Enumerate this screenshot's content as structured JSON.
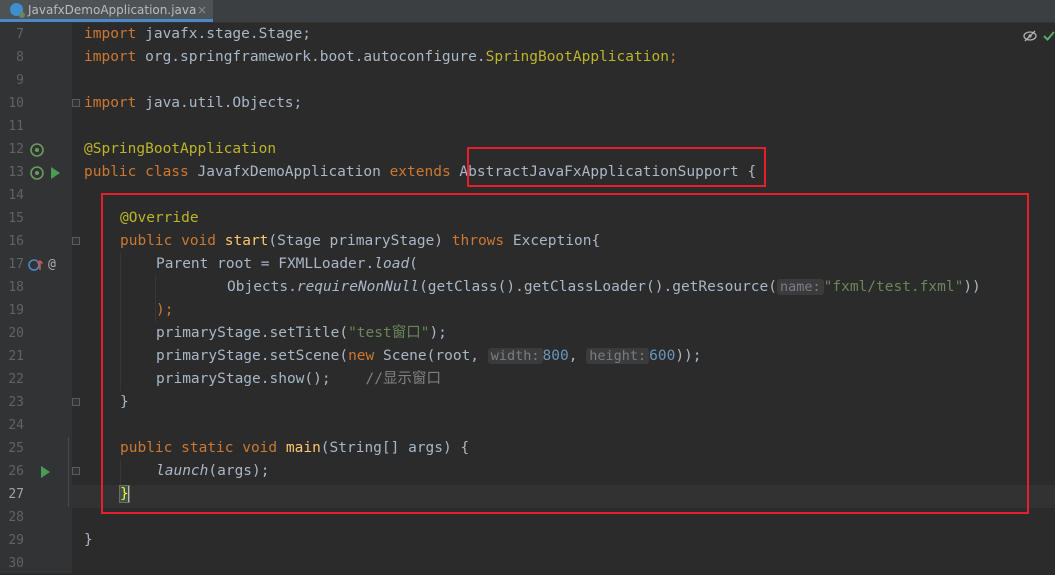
{
  "tab": {
    "file_name": "JavafxDemoApplication.java",
    "close_glyph": "×"
  },
  "gutter": {
    "line_numbers": [
      "7",
      "8",
      "9",
      "10",
      "11",
      "12",
      "13",
      "14",
      "15",
      "16",
      "17",
      "18",
      "19",
      "20",
      "21",
      "22",
      "23",
      "24",
      "25",
      "26",
      "27",
      "28",
      "29",
      "30"
    ],
    "current_line": "27",
    "icons": {
      "spring_bean": "spring-bean-icon",
      "run": "run-icon",
      "override": "override-icon",
      "annotation": "annotation-icon"
    }
  },
  "code": {
    "l7": [
      "import",
      " javafx.stage.Stage;"
    ],
    "l8": [
      "import",
      " org.springframework.boot.autoconfigure.",
      "SpringBootApplication",
      ";"
    ],
    "l10": [
      "import",
      " java.util.Objects;"
    ],
    "l12": [
      "@SpringBootApplication"
    ],
    "l13": [
      "public class",
      " JavafxDemoApplication ",
      "extends",
      " ",
      "AbstractJavaFxApplicationSupport",
      " {"
    ],
    "l15": [
      "@Override"
    ],
    "l16": [
      "public void",
      " ",
      "start",
      "(Stage primaryStage) ",
      "throws",
      " Exception{"
    ],
    "l17": [
      "Parent root = FXMLLoader.",
      "load",
      "("
    ],
    "l18": [
      "Objects.",
      "requireNonNull",
      "(getClass().getClassLoader().getResource(",
      "name:",
      "\"fxml/test.fxml\"",
      "))"
    ],
    "l19": [
      ");"
    ],
    "l20": [
      "primaryStage.setTitle(",
      "\"test窗口\"",
      ");"
    ],
    "l21": [
      "primaryStage.setScene(",
      "new",
      " Scene(root, ",
      "width:",
      "800",
      ", ",
      "height:",
      "600",
      "));"
    ],
    "l22": [
      "primaryStage.show();",
      "//显示窗口"
    ],
    "l23": [
      "}"
    ],
    "l25": [
      "public static void",
      " ",
      "main",
      "(String[] args) {"
    ],
    "l26": [
      "launch",
      "(args);"
    ],
    "l27": [
      "}"
    ],
    "l29": [
      "}"
    ]
  },
  "status": {
    "hide_icon": "eye-crossed-icon",
    "ok_icon": "check-icon"
  },
  "colors": {
    "background": "#2b2b2b",
    "keyword": "#cc7832",
    "annotation": "#bbb529",
    "method": "#ffc66d",
    "string": "#6a8759",
    "number": "#6897bb",
    "highlight_box": "#e81e2b"
  }
}
